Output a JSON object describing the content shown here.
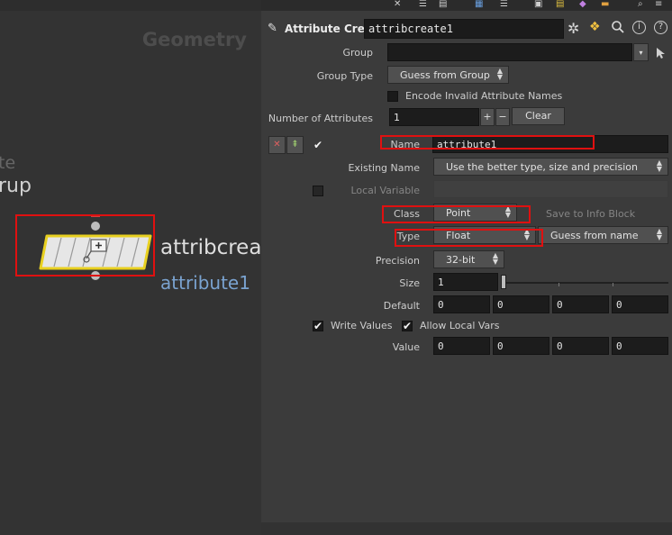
{
  "network": {
    "context_label": "Geometry",
    "ctx_fragment_1": "te",
    "ctx_fragment_2": "rup",
    "node_name": "attribcreat",
    "node_subtitle": "attribute1"
  },
  "header": {
    "node_type": "Attribute Create",
    "node_name": "attribcreate1"
  },
  "params": {
    "group_label": "Group",
    "group_value": "",
    "group_type_label": "Group Type",
    "group_type_value": "Guess from Group",
    "encode_label": "Encode Invalid Attribute Names",
    "num_attrs_label": "Number of Attributes",
    "num_attrs_value": "1",
    "plus": "+",
    "minus": "−",
    "clear_label": "Clear",
    "name_label": "Name",
    "name_value": "attribute1",
    "existing_name_label": "Existing Name",
    "existing_name_value": "Use the better type, size and precision",
    "local_variable_label": "Local Variable",
    "local_variable_value": "",
    "class_label": "Class",
    "class_value": "Point",
    "save_info_label": "Save to Info Block",
    "type_label": "Type",
    "type_value": "Float",
    "guess_label": "Guess from name",
    "precision_label": "Precision",
    "precision_value": "32-bit",
    "size_label": "Size",
    "size_value": "1",
    "default_label": "Default",
    "default_values": [
      "0",
      "0",
      "0",
      "0"
    ],
    "write_values_label": "Write Values",
    "allow_local_vars_label": "Allow Local Vars",
    "value_label": "Value",
    "value_values": [
      "0",
      "0",
      "0",
      "0"
    ]
  },
  "icons": {
    "node_type": "attribcreate-icon",
    "gear": "gear-icon",
    "python": "python-icon",
    "search": "search-icon",
    "info": "info-icon",
    "help": "help-icon"
  },
  "colors": {
    "node_fill": "#e6e6e6",
    "node_outline": "#e8d020",
    "highlight": "#e01010",
    "subtitle": "#7aa3d0"
  }
}
